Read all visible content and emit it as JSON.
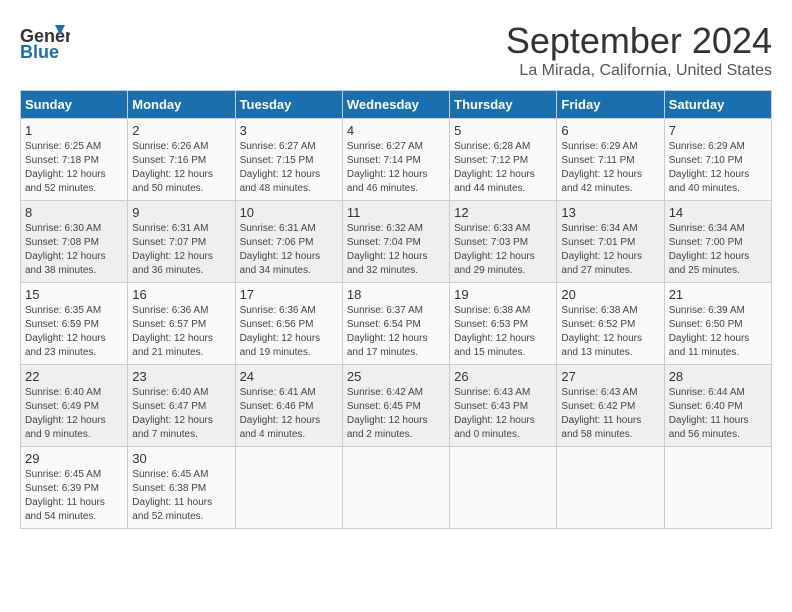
{
  "header": {
    "logo_line1": "General",
    "logo_line2": "Blue",
    "month": "September 2024",
    "location": "La Mirada, California, United States"
  },
  "days_of_week": [
    "Sunday",
    "Monday",
    "Tuesday",
    "Wednesday",
    "Thursday",
    "Friday",
    "Saturday"
  ],
  "weeks": [
    [
      {
        "day": "1",
        "info": "Sunrise: 6:25 AM\nSunset: 7:18 PM\nDaylight: 12 hours\nand 52 minutes."
      },
      {
        "day": "2",
        "info": "Sunrise: 6:26 AM\nSunset: 7:16 PM\nDaylight: 12 hours\nand 50 minutes."
      },
      {
        "day": "3",
        "info": "Sunrise: 6:27 AM\nSunset: 7:15 PM\nDaylight: 12 hours\nand 48 minutes."
      },
      {
        "day": "4",
        "info": "Sunrise: 6:27 AM\nSunset: 7:14 PM\nDaylight: 12 hours\nand 46 minutes."
      },
      {
        "day": "5",
        "info": "Sunrise: 6:28 AM\nSunset: 7:12 PM\nDaylight: 12 hours\nand 44 minutes."
      },
      {
        "day": "6",
        "info": "Sunrise: 6:29 AM\nSunset: 7:11 PM\nDaylight: 12 hours\nand 42 minutes."
      },
      {
        "day": "7",
        "info": "Sunrise: 6:29 AM\nSunset: 7:10 PM\nDaylight: 12 hours\nand 40 minutes."
      }
    ],
    [
      {
        "day": "8",
        "info": "Sunrise: 6:30 AM\nSunset: 7:08 PM\nDaylight: 12 hours\nand 38 minutes."
      },
      {
        "day": "9",
        "info": "Sunrise: 6:31 AM\nSunset: 7:07 PM\nDaylight: 12 hours\nand 36 minutes."
      },
      {
        "day": "10",
        "info": "Sunrise: 6:31 AM\nSunset: 7:06 PM\nDaylight: 12 hours\nand 34 minutes."
      },
      {
        "day": "11",
        "info": "Sunrise: 6:32 AM\nSunset: 7:04 PM\nDaylight: 12 hours\nand 32 minutes."
      },
      {
        "day": "12",
        "info": "Sunrise: 6:33 AM\nSunset: 7:03 PM\nDaylight: 12 hours\nand 29 minutes."
      },
      {
        "day": "13",
        "info": "Sunrise: 6:34 AM\nSunset: 7:01 PM\nDaylight: 12 hours\nand 27 minutes."
      },
      {
        "day": "14",
        "info": "Sunrise: 6:34 AM\nSunset: 7:00 PM\nDaylight: 12 hours\nand 25 minutes."
      }
    ],
    [
      {
        "day": "15",
        "info": "Sunrise: 6:35 AM\nSunset: 6:59 PM\nDaylight: 12 hours\nand 23 minutes."
      },
      {
        "day": "16",
        "info": "Sunrise: 6:36 AM\nSunset: 6:57 PM\nDaylight: 12 hours\nand 21 minutes."
      },
      {
        "day": "17",
        "info": "Sunrise: 6:36 AM\nSunset: 6:56 PM\nDaylight: 12 hours\nand 19 minutes."
      },
      {
        "day": "18",
        "info": "Sunrise: 6:37 AM\nSunset: 6:54 PM\nDaylight: 12 hours\nand 17 minutes."
      },
      {
        "day": "19",
        "info": "Sunrise: 6:38 AM\nSunset: 6:53 PM\nDaylight: 12 hours\nand 15 minutes."
      },
      {
        "day": "20",
        "info": "Sunrise: 6:38 AM\nSunset: 6:52 PM\nDaylight: 12 hours\nand 13 minutes."
      },
      {
        "day": "21",
        "info": "Sunrise: 6:39 AM\nSunset: 6:50 PM\nDaylight: 12 hours\nand 11 minutes."
      }
    ],
    [
      {
        "day": "22",
        "info": "Sunrise: 6:40 AM\nSunset: 6:49 PM\nDaylight: 12 hours\nand 9 minutes."
      },
      {
        "day": "23",
        "info": "Sunrise: 6:40 AM\nSunset: 6:47 PM\nDaylight: 12 hours\nand 7 minutes."
      },
      {
        "day": "24",
        "info": "Sunrise: 6:41 AM\nSunset: 6:46 PM\nDaylight: 12 hours\nand 4 minutes."
      },
      {
        "day": "25",
        "info": "Sunrise: 6:42 AM\nSunset: 6:45 PM\nDaylight: 12 hours\nand 2 minutes."
      },
      {
        "day": "26",
        "info": "Sunrise: 6:43 AM\nSunset: 6:43 PM\nDaylight: 12 hours\nand 0 minutes."
      },
      {
        "day": "27",
        "info": "Sunrise: 6:43 AM\nSunset: 6:42 PM\nDaylight: 11 hours\nand 58 minutes."
      },
      {
        "day": "28",
        "info": "Sunrise: 6:44 AM\nSunset: 6:40 PM\nDaylight: 11 hours\nand 56 minutes."
      }
    ],
    [
      {
        "day": "29",
        "info": "Sunrise: 6:45 AM\nSunset: 6:39 PM\nDaylight: 11 hours\nand 54 minutes."
      },
      {
        "day": "30",
        "info": "Sunrise: 6:45 AM\nSunset: 6:38 PM\nDaylight: 11 hours\nand 52 minutes."
      },
      {
        "day": "",
        "info": ""
      },
      {
        "day": "",
        "info": ""
      },
      {
        "day": "",
        "info": ""
      },
      {
        "day": "",
        "info": ""
      },
      {
        "day": "",
        "info": ""
      }
    ]
  ]
}
